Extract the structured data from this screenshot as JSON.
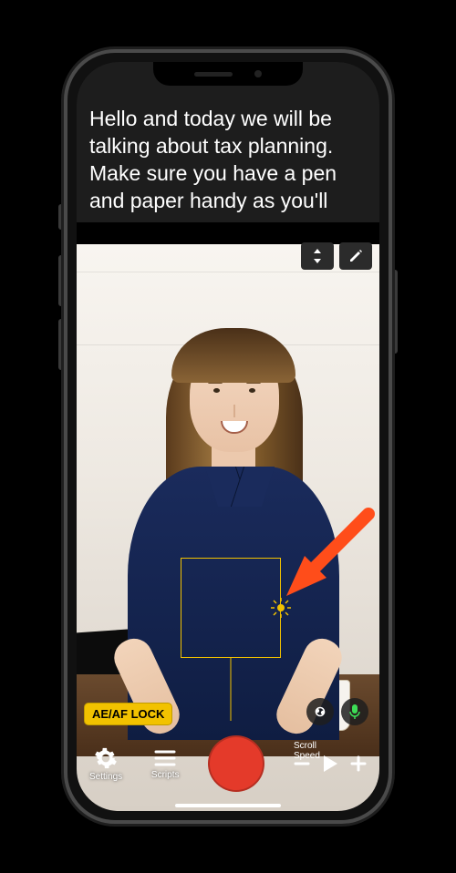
{
  "script": {
    "text": "Hello and today we will be talking about tax planning. Make sure you have a pen and paper handy as you'll"
  },
  "script_controls": {
    "scroll_icon": "scroll-updown-icon",
    "edit_icon": "pencil-icon"
  },
  "camera": {
    "aeaf_label": "AE/AF LOCK",
    "focus_icon": "sun-icon",
    "camswap_icon": "camera-swap-icon",
    "mic_icon": "microphone-icon"
  },
  "toolbar": {
    "settings": {
      "icon": "gear-icon",
      "label": "Settings"
    },
    "scripts": {
      "icon": "menu-icon",
      "label": "Scripts"
    },
    "record": {
      "icon": "record-icon"
    },
    "speed": {
      "minus_icon": "minus-icon",
      "play_icon": "play-icon",
      "plus_icon": "plus-icon",
      "label": "Scroll Speed"
    }
  },
  "colors": {
    "record": "#e43a2a",
    "focus": "#f2c200",
    "annotation": "#ff4d1a"
  }
}
